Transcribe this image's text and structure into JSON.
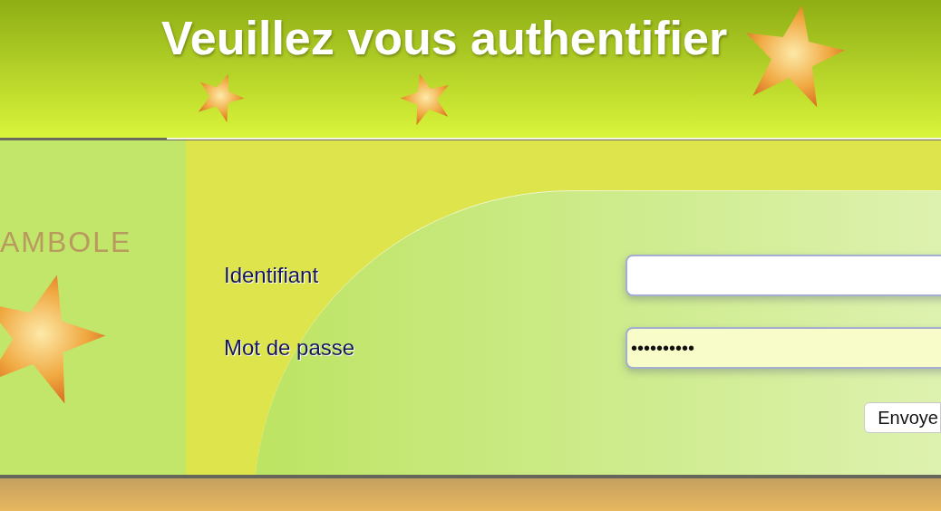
{
  "header": {
    "title": "Veuillez vous authentifier"
  },
  "brand": {
    "text": "AMBOLE"
  },
  "form": {
    "fields": [
      {
        "label": "Identifiant",
        "focused": false
      },
      {
        "label": "Mot de passe",
        "value": "••••••••••",
        "focused": true
      }
    ],
    "submit": "Envoye"
  }
}
